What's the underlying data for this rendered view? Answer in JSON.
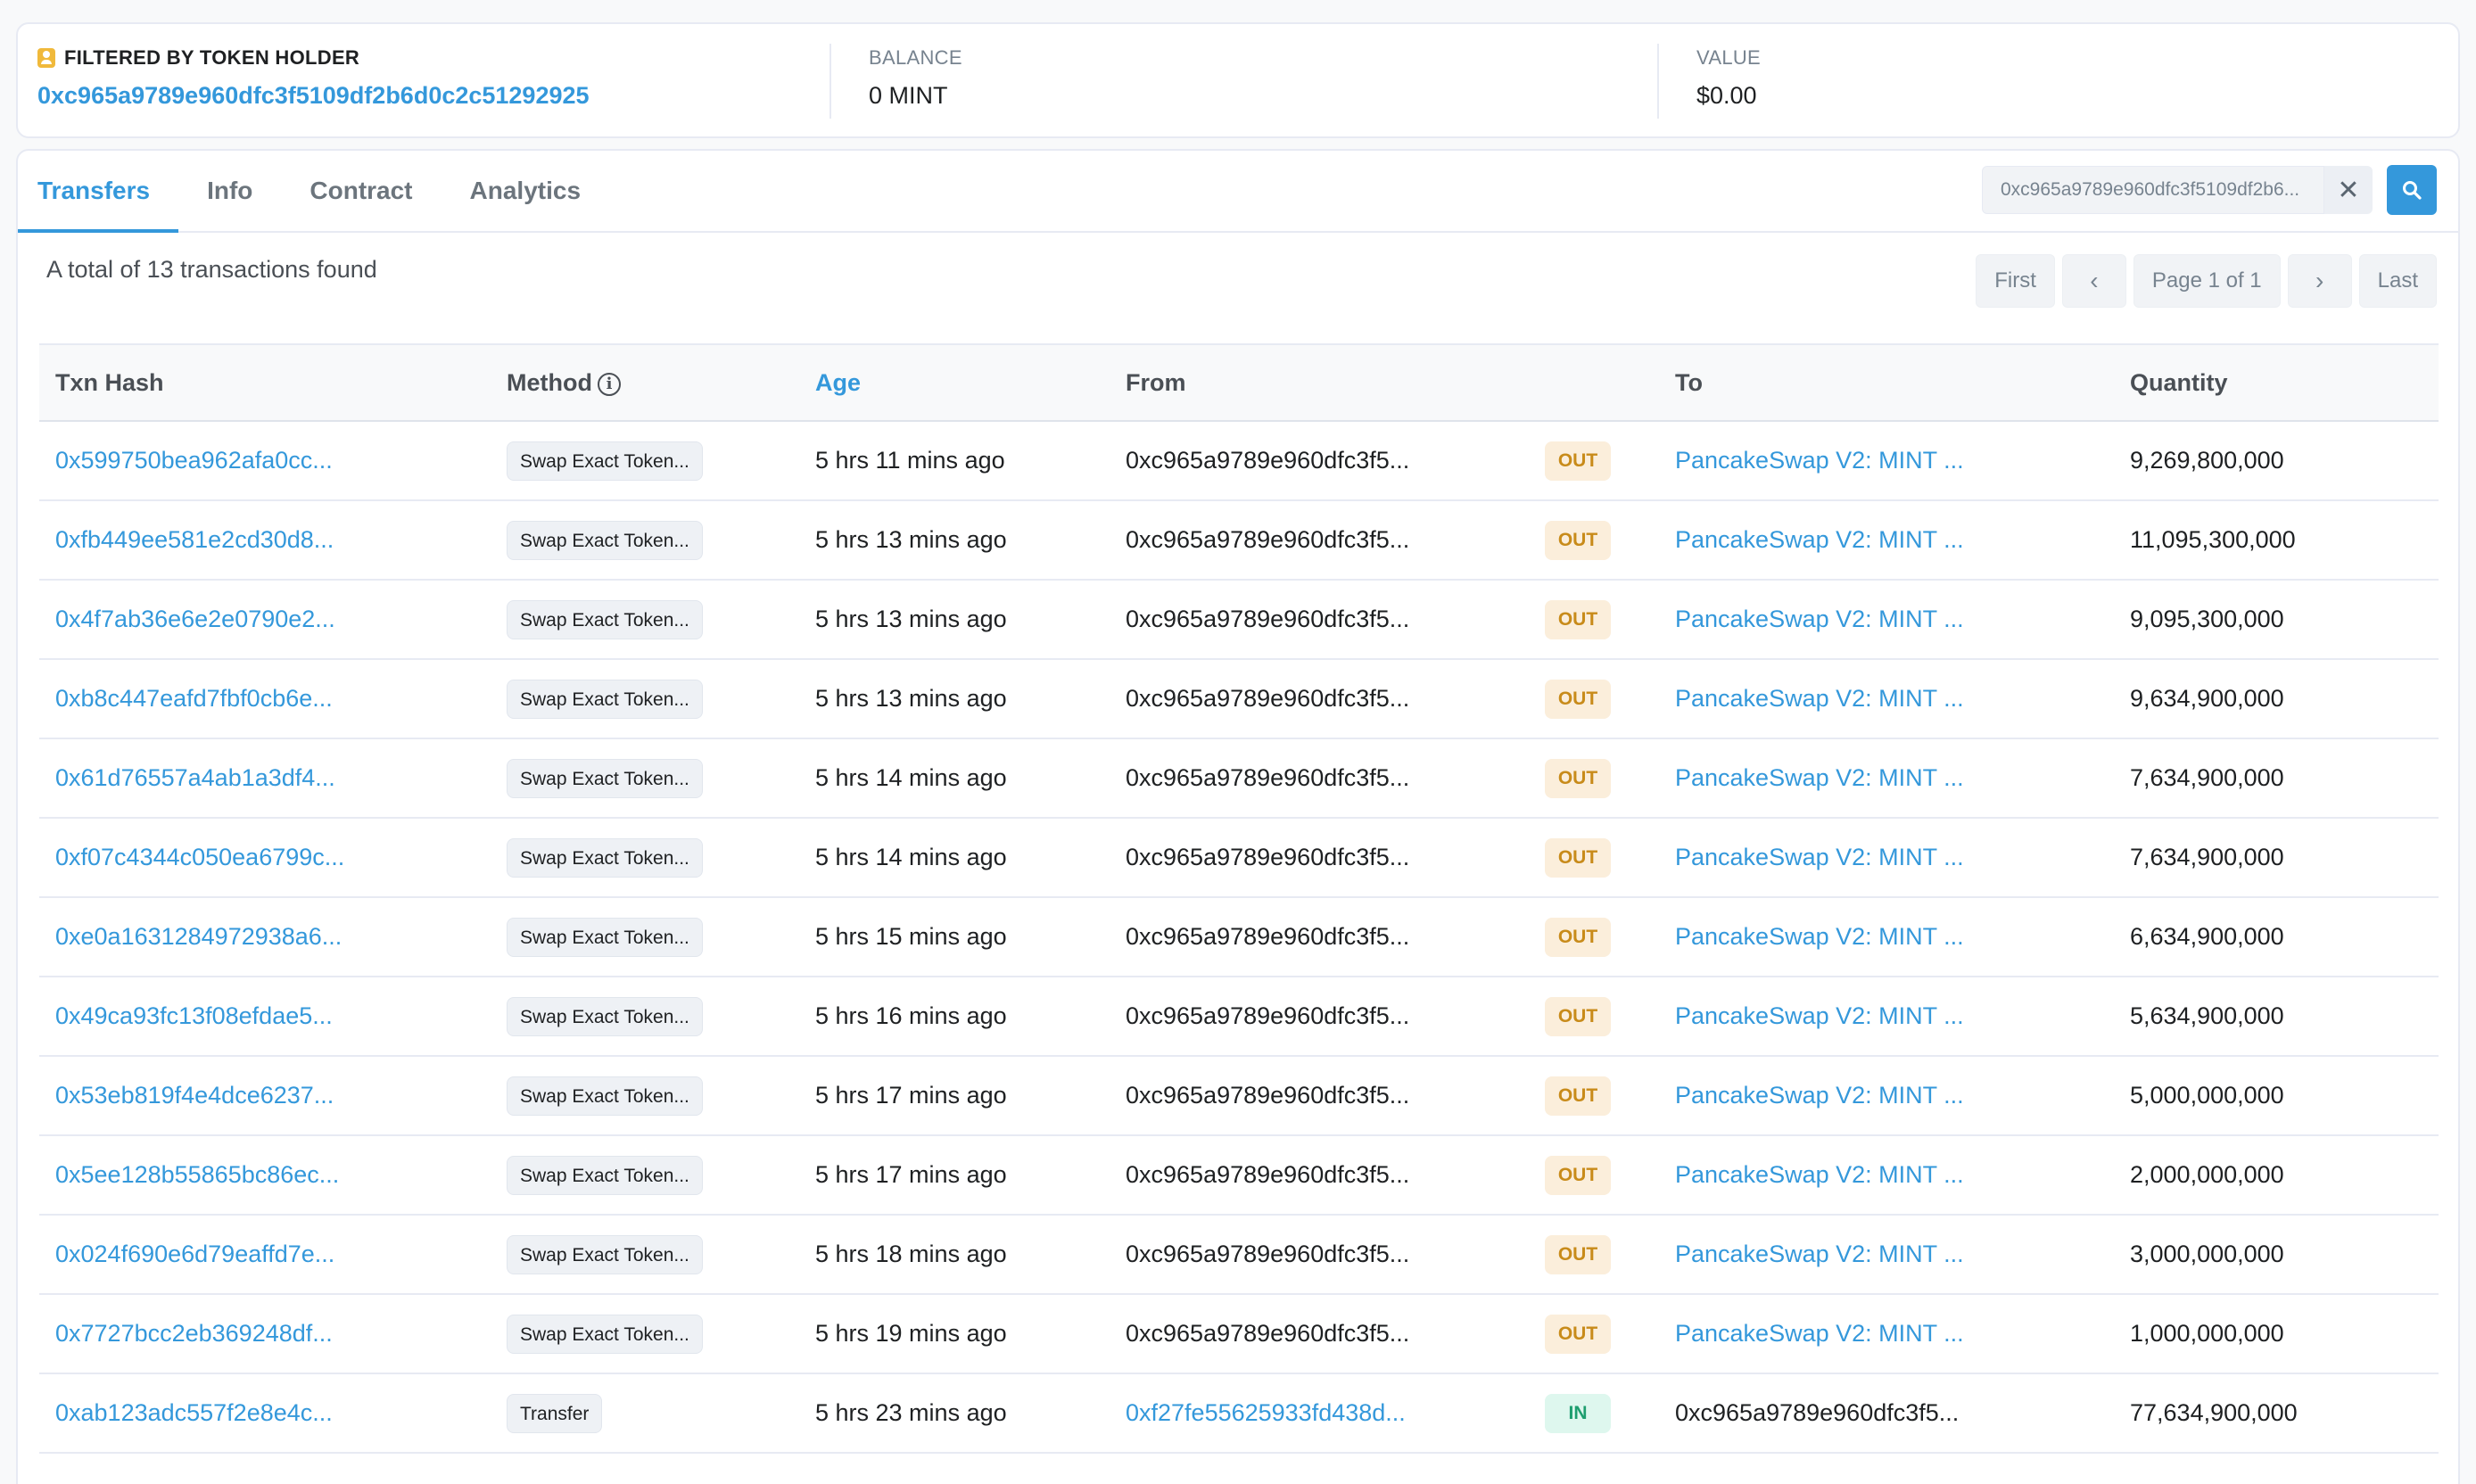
{
  "summary": {
    "filter_label": "FILTERED BY TOKEN HOLDER",
    "holder_address": "0xc965a9789e960dfc3f5109df2b6d0c2c51292925",
    "balance_label": "BALANCE",
    "balance_value": "0 MINT",
    "value_label": "VALUE",
    "value_value": "$0.00"
  },
  "tabs": [
    {
      "label": "Transfers",
      "active": true
    },
    {
      "label": "Info",
      "active": false
    },
    {
      "label": "Contract",
      "active": false
    },
    {
      "label": "Analytics",
      "active": false
    }
  ],
  "search": {
    "value": "0xc965a9789e960dfc3f5109df2b6...",
    "clear_icon": "✕"
  },
  "total_text": "A total of 13 transactions found",
  "pager": {
    "first": "First",
    "prev": "‹",
    "page": "Page 1 of 1",
    "next": "›",
    "last": "Last"
  },
  "table": {
    "headers": {
      "hash": "Txn Hash",
      "method": "Method",
      "age": "Age",
      "from": "From",
      "to": "To",
      "qty": "Quantity"
    },
    "rows": [
      {
        "hash": "0x599750bea962afa0cc...",
        "method": "Swap Exact Token...",
        "age": "5 hrs 11 mins ago",
        "from": "0xc965a9789e960dfc3f5...",
        "dir": "OUT",
        "to": "PancakeSwap V2: MINT ...",
        "qty": "9,269,800,000"
      },
      {
        "hash": "0xfb449ee581e2cd30d8...",
        "method": "Swap Exact Token...",
        "age": "5 hrs 13 mins ago",
        "from": "0xc965a9789e960dfc3f5...",
        "dir": "OUT",
        "to": "PancakeSwap V2: MINT ...",
        "qty": "11,095,300,000"
      },
      {
        "hash": "0x4f7ab36e6e2e0790e2...",
        "method": "Swap Exact Token...",
        "age": "5 hrs 13 mins ago",
        "from": "0xc965a9789e960dfc3f5...",
        "dir": "OUT",
        "to": "PancakeSwap V2: MINT ...",
        "qty": "9,095,300,000"
      },
      {
        "hash": "0xb8c447eafd7fbf0cb6e...",
        "method": "Swap Exact Token...",
        "age": "5 hrs 13 mins ago",
        "from": "0xc965a9789e960dfc3f5...",
        "dir": "OUT",
        "to": "PancakeSwap V2: MINT ...",
        "qty": "9,634,900,000"
      },
      {
        "hash": "0x61d76557a4ab1a3df4...",
        "method": "Swap Exact Token...",
        "age": "5 hrs 14 mins ago",
        "from": "0xc965a9789e960dfc3f5...",
        "dir": "OUT",
        "to": "PancakeSwap V2: MINT ...",
        "qty": "7,634,900,000"
      },
      {
        "hash": "0xf07c4344c050ea6799c...",
        "method": "Swap Exact Token...",
        "age": "5 hrs 14 mins ago",
        "from": "0xc965a9789e960dfc3f5...",
        "dir": "OUT",
        "to": "PancakeSwap V2: MINT ...",
        "qty": "7,634,900,000"
      },
      {
        "hash": "0xe0a1631284972938a6...",
        "method": "Swap Exact Token...",
        "age": "5 hrs 15 mins ago",
        "from": "0xc965a9789e960dfc3f5...",
        "dir": "OUT",
        "to": "PancakeSwap V2: MINT ...",
        "qty": "6,634,900,000"
      },
      {
        "hash": "0x49ca93fc13f08efdae5...",
        "method": "Swap Exact Token...",
        "age": "5 hrs 16 mins ago",
        "from": "0xc965a9789e960dfc3f5...",
        "dir": "OUT",
        "to": "PancakeSwap V2: MINT ...",
        "qty": "5,634,900,000"
      },
      {
        "hash": "0x53eb819f4e4dce6237...",
        "method": "Swap Exact Token...",
        "age": "5 hrs 17 mins ago",
        "from": "0xc965a9789e960dfc3f5...",
        "dir": "OUT",
        "to": "PancakeSwap V2: MINT ...",
        "qty": "5,000,000,000"
      },
      {
        "hash": "0x5ee128b55865bc86ec...",
        "method": "Swap Exact Token...",
        "age": "5 hrs 17 mins ago",
        "from": "0xc965a9789e960dfc3f5...",
        "dir": "OUT",
        "to": "PancakeSwap V2: MINT ...",
        "qty": "2,000,000,000"
      },
      {
        "hash": "0x024f690e6d79eaffd7e...",
        "method": "Swap Exact Token...",
        "age": "5 hrs 18 mins ago",
        "from": "0xc965a9789e960dfc3f5...",
        "dir": "OUT",
        "to": "PancakeSwap V2: MINT ...",
        "qty": "3,000,000,000"
      },
      {
        "hash": "0x7727bcc2eb369248df...",
        "method": "Swap Exact Token...",
        "age": "5 hrs 19 mins ago",
        "from": "0xc965a9789e960dfc3f5...",
        "dir": "OUT",
        "to": "PancakeSwap V2: MINT ...",
        "qty": "1,000,000,000"
      },
      {
        "hash": "0xab123adc557f2e8e4c...",
        "method": "Transfer",
        "age": "5 hrs 23 mins ago",
        "from": "0xf27fe55625933fd438d...",
        "dir": "IN",
        "to": "0xc965a9789e960dfc3f5...",
        "qty": "77,634,900,000",
        "from_is_link": true,
        "to_is_link": false
      }
    ]
  },
  "colors": {
    "accent": "#3498db",
    "out_badge_bg": "#fbeedb",
    "out_badge_text": "#c88b1a",
    "in_badge_bg": "#def7ee",
    "in_badge_text": "#1e9e6f"
  }
}
